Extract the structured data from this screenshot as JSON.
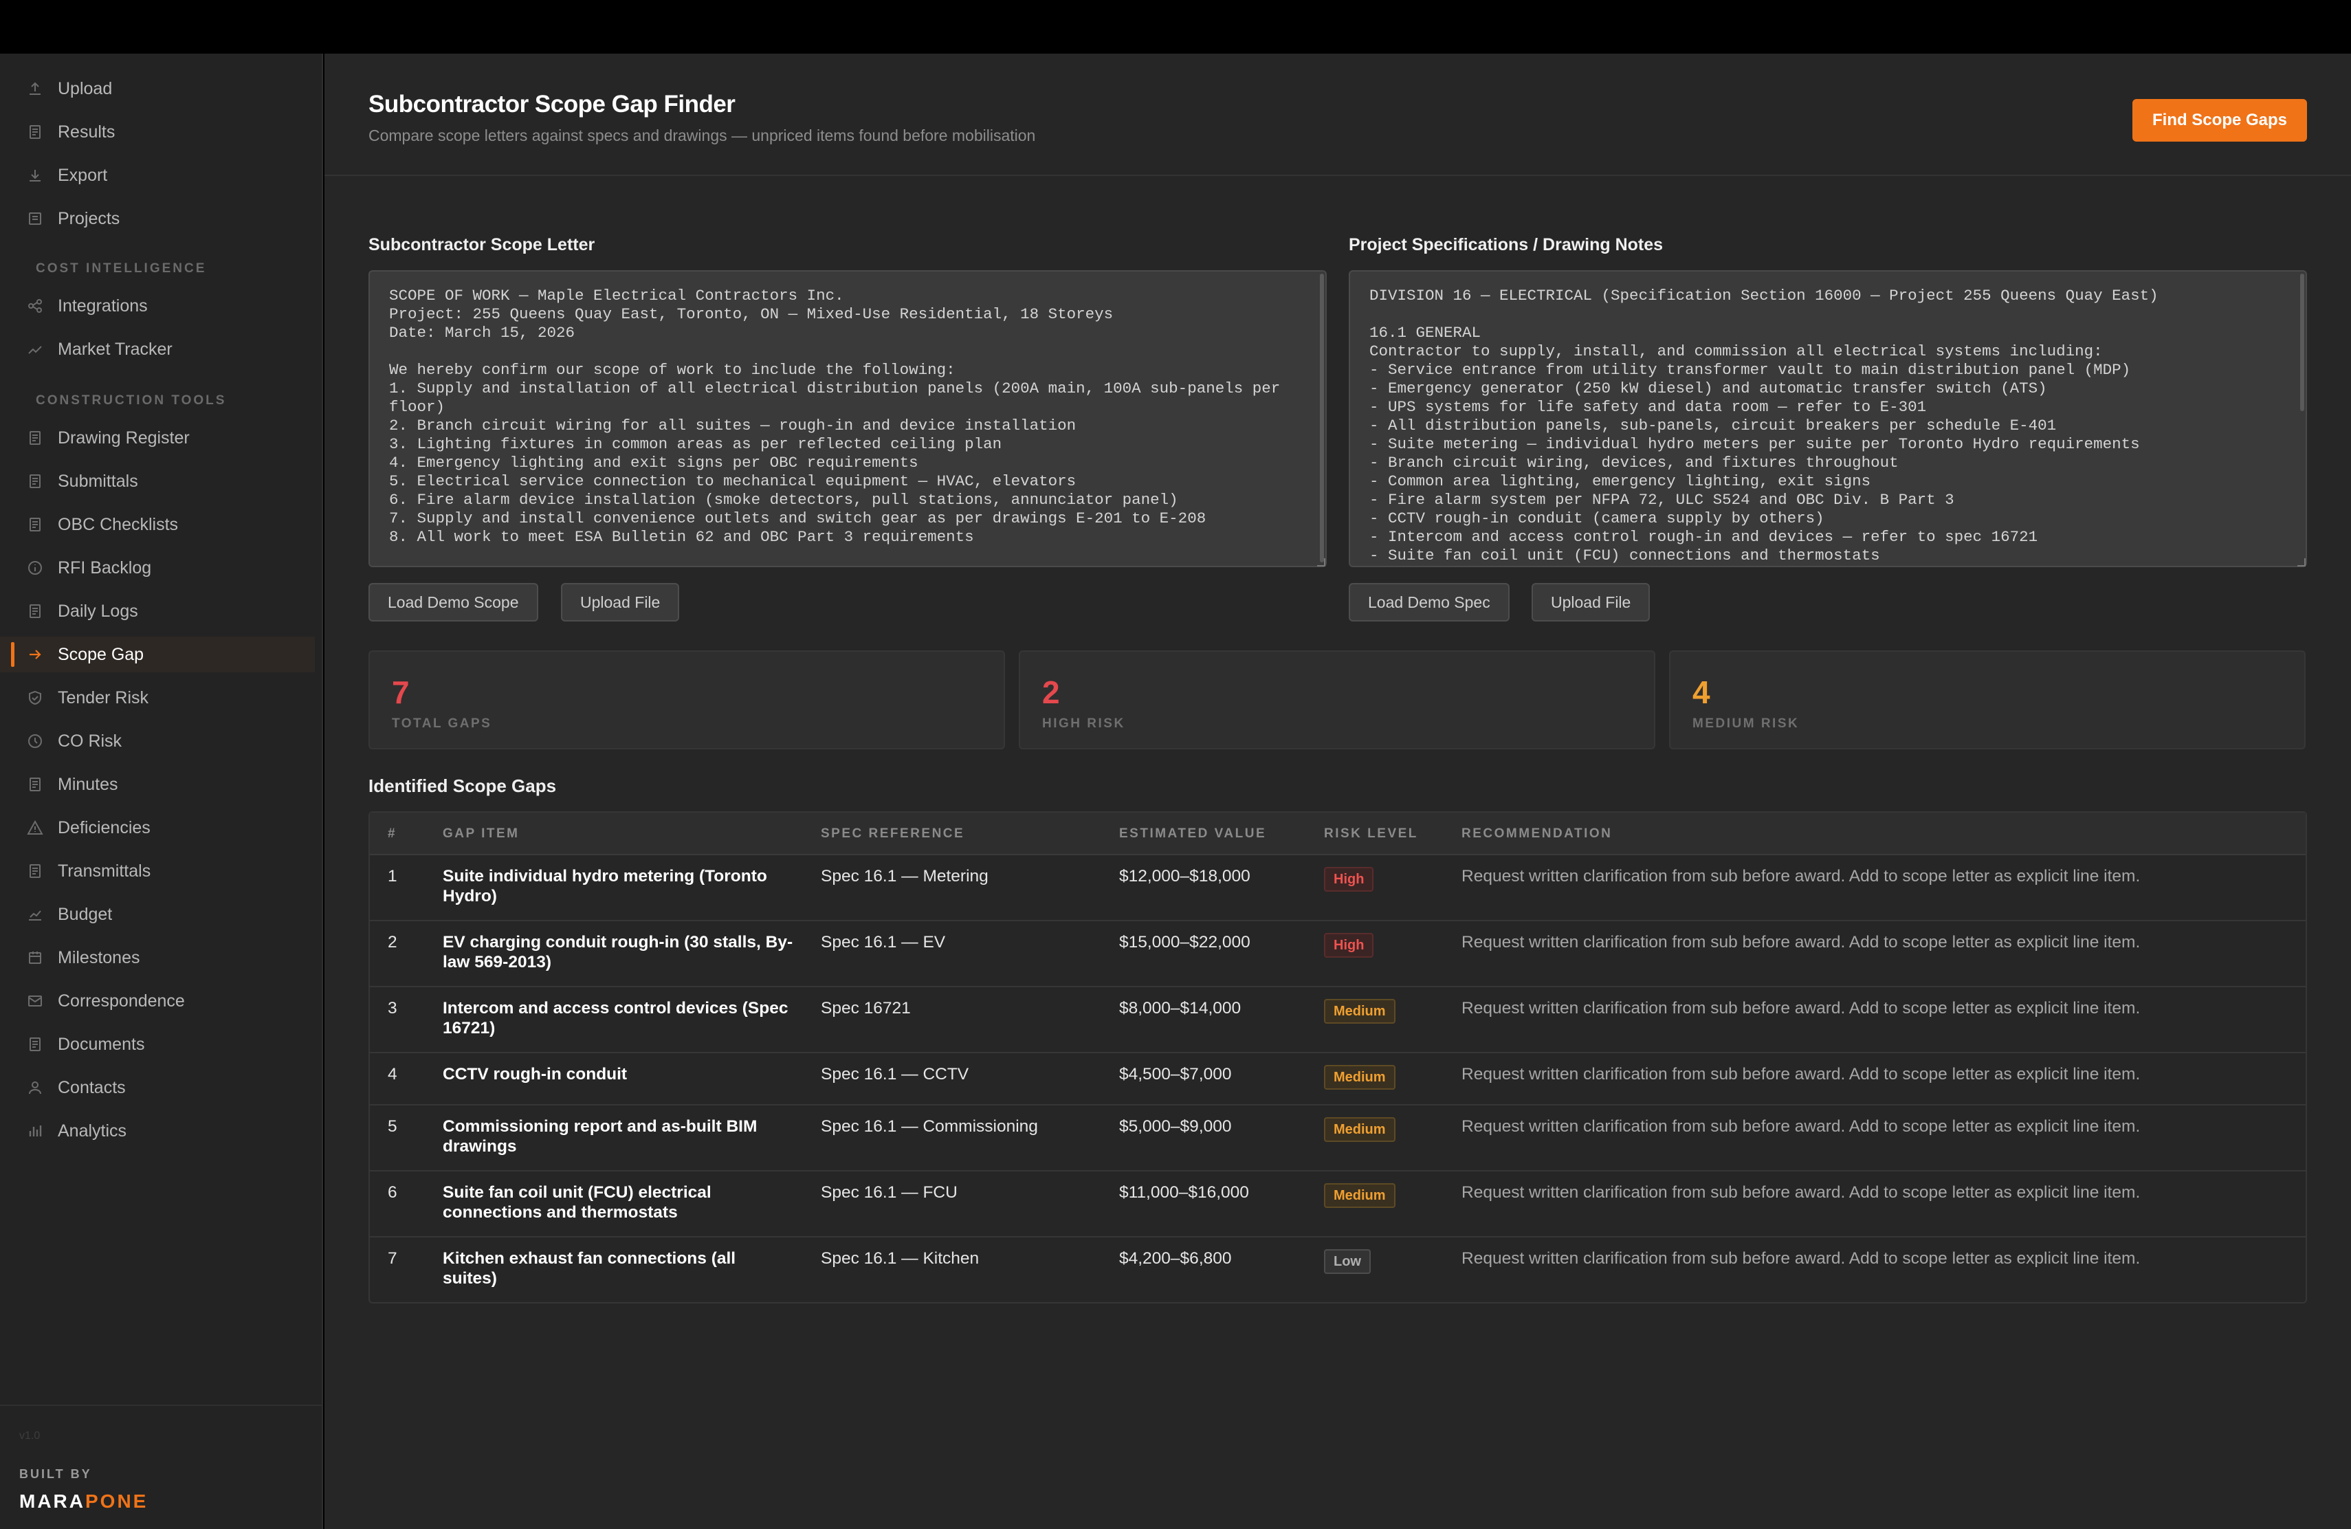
{
  "sidebar": {
    "items_top": [
      {
        "label": "Upload",
        "icon": "upload-icon"
      },
      {
        "label": "Results",
        "icon": "document-icon"
      },
      {
        "label": "Export",
        "icon": "export-icon"
      },
      {
        "label": "Projects",
        "icon": "folder-icon"
      }
    ],
    "section_cost": "COST INTELLIGENCE",
    "items_cost": [
      {
        "label": "Integrations",
        "icon": "integrations-icon"
      },
      {
        "label": "Market Tracker",
        "icon": "trend-icon"
      }
    ],
    "section_tools": "CONSTRUCTION TOOLS",
    "items_tools": [
      {
        "label": "Drawing Register",
        "icon": "document-icon"
      },
      {
        "label": "Submittals",
        "icon": "document-icon"
      },
      {
        "label": "OBC Checklists",
        "icon": "document-icon"
      },
      {
        "label": "RFI Backlog",
        "icon": "info-icon"
      },
      {
        "label": "Daily Logs",
        "icon": "document-icon"
      },
      {
        "label": "Scope Gap",
        "icon": "arrow-right-icon",
        "active": true
      },
      {
        "label": "Tender Risk",
        "icon": "shield-icon"
      },
      {
        "label": "CO Risk",
        "icon": "clock-icon"
      },
      {
        "label": "Minutes",
        "icon": "document-icon"
      },
      {
        "label": "Deficiencies",
        "icon": "warning-icon"
      },
      {
        "label": "Transmittals",
        "icon": "document-icon"
      },
      {
        "label": "Budget",
        "icon": "chart-icon"
      },
      {
        "label": "Milestones",
        "icon": "calendar-icon"
      },
      {
        "label": "Correspondence",
        "icon": "mail-icon"
      },
      {
        "label": "Documents",
        "icon": "document-icon"
      },
      {
        "label": "Contacts",
        "icon": "user-icon"
      },
      {
        "label": "Analytics",
        "icon": "bar-chart-icon"
      }
    ],
    "version": "v1.0",
    "built_by": "BUILT BY",
    "brand_part1": "MARA",
    "brand_part2": "PONE"
  },
  "header": {
    "title": "Subcontractor Scope Gap Finder",
    "subtitle": "Compare scope letters against specs and drawings — unpriced items found before mobilisation",
    "primary_button": "Find Scope Gaps"
  },
  "scope_panel": {
    "label": "Subcontractor Scope Letter",
    "text": "SCOPE OF WORK — Maple Electrical Contractors Inc.\nProject: 255 Queens Quay East, Toronto, ON — Mixed-Use Residential, 18 Storeys\nDate: March 15, 2026\n\nWe hereby confirm our scope of work to include the following:\n1. Supply and installation of all electrical distribution panels (200A main, 100A sub-panels per floor)\n2. Branch circuit wiring for all suites — rough-in and device installation\n3. Lighting fixtures in common areas as per reflected ceiling plan\n4. Emergency lighting and exit signs per OBC requirements\n5. Electrical service connection to mechanical equipment — HVAC, elevators\n6. Fire alarm device installation (smoke detectors, pull stations, annunciator panel)\n7. Supply and install convenience outlets and switch gear as per drawings E-201 to E-208\n8. All work to meet ESA Bulletin 62 and OBC Part 3 requirements",
    "demo_button": "Load Demo Scope",
    "upload_button": "Upload File"
  },
  "spec_panel": {
    "label": "Project Specifications / Drawing Notes",
    "text": "DIVISION 16 — ELECTRICAL (Specification Section 16000 — Project 255 Queens Quay East)\n\n16.1 GENERAL\nContractor to supply, install, and commission all electrical systems including:\n- Service entrance from utility transformer vault to main distribution panel (MDP)\n- Emergency generator (250 kW diesel) and automatic transfer switch (ATS)\n- UPS systems for life safety and data room — refer to E-301\n- All distribution panels, sub-panels, circuit breakers per schedule E-401\n- Suite metering — individual hydro meters per suite per Toronto Hydro requirements\n- Branch circuit wiring, devices, and fixtures throughout\n- Common area lighting, emergency lighting, exit signs\n- Fire alarm system per NFPA 72, ULC S524 and OBC Div. B Part 3\n- CCTV rough-in conduit (camera supply by others)\n- Intercom and access control rough-in and devices — refer to spec 16721\n- Suite fan coil unit (FCU) connections and thermostats",
    "demo_button": "Load Demo Spec",
    "upload_button": "Upload File"
  },
  "stats": [
    {
      "value": "7",
      "label": "TOTAL GAPS",
      "color": "#e5484d"
    },
    {
      "value": "2",
      "label": "HIGH RISK",
      "color": "#e5484d"
    },
    {
      "value": "4",
      "label": "MEDIUM RISK",
      "color": "#f0a030"
    }
  ],
  "gaps_title": "Identified Scope Gaps",
  "table": {
    "headers": [
      "#",
      "GAP ITEM",
      "SPEC REFERENCE",
      "ESTIMATED VALUE",
      "RISK LEVEL",
      "RECOMMENDATION"
    ],
    "rows": [
      {
        "num": "1",
        "item": "Suite individual hydro metering (Toronto Hydro)",
        "spec": "Spec 16.1 — Metering",
        "value": "$12,000–$18,000",
        "risk": "High",
        "risk_class": "high",
        "rec": "Request written clarification from sub before award. Add to scope letter as explicit line item."
      },
      {
        "num": "2",
        "item": "EV charging conduit rough-in (30 stalls, By-law 569-2013)",
        "spec": "Spec 16.1 — EV",
        "value": "$15,000–$22,000",
        "risk": "High",
        "risk_class": "high",
        "rec": "Request written clarification from sub before award. Add to scope letter as explicit line item."
      },
      {
        "num": "3",
        "item": "Intercom and access control devices (Spec 16721)",
        "spec": "Spec 16721",
        "value": "$8,000–$14,000",
        "risk": "Medium",
        "risk_class": "medium",
        "rec": "Request written clarification from sub before award. Add to scope letter as explicit line item."
      },
      {
        "num": "4",
        "item": "CCTV rough-in conduit",
        "spec": "Spec 16.1 — CCTV",
        "value": "$4,500–$7,000",
        "risk": "Medium",
        "risk_class": "medium",
        "rec": "Request written clarification from sub before award. Add to scope letter as explicit line item."
      },
      {
        "num": "5",
        "item": "Commissioning report and as-built BIM drawings",
        "spec": "Spec 16.1 — Commissioning",
        "value": "$5,000–$9,000",
        "risk": "Medium",
        "risk_class": "medium",
        "rec": "Request written clarification from sub before award. Add to scope letter as explicit line item."
      },
      {
        "num": "6",
        "item": "Suite fan coil unit (FCU) electrical connections and thermostats",
        "spec": "Spec 16.1 — FCU",
        "value": "$11,000–$16,000",
        "risk": "Medium",
        "risk_class": "medium",
        "rec": "Request written clarification from sub before award. Add to scope letter as explicit line item."
      },
      {
        "num": "7",
        "item": "Kitchen exhaust fan connections (all suites)",
        "spec": "Spec 16.1 — Kitchen",
        "value": "$4,200–$6,800",
        "risk": "Low",
        "risk_class": "low",
        "rec": "Request written clarification from sub before award. Add to scope letter as explicit line item."
      }
    ]
  },
  "colors": {
    "accent": "#f07318",
    "high": "#e5484d",
    "medium": "#f0a030",
    "background": "#262626",
    "sidebar": "#232323"
  }
}
